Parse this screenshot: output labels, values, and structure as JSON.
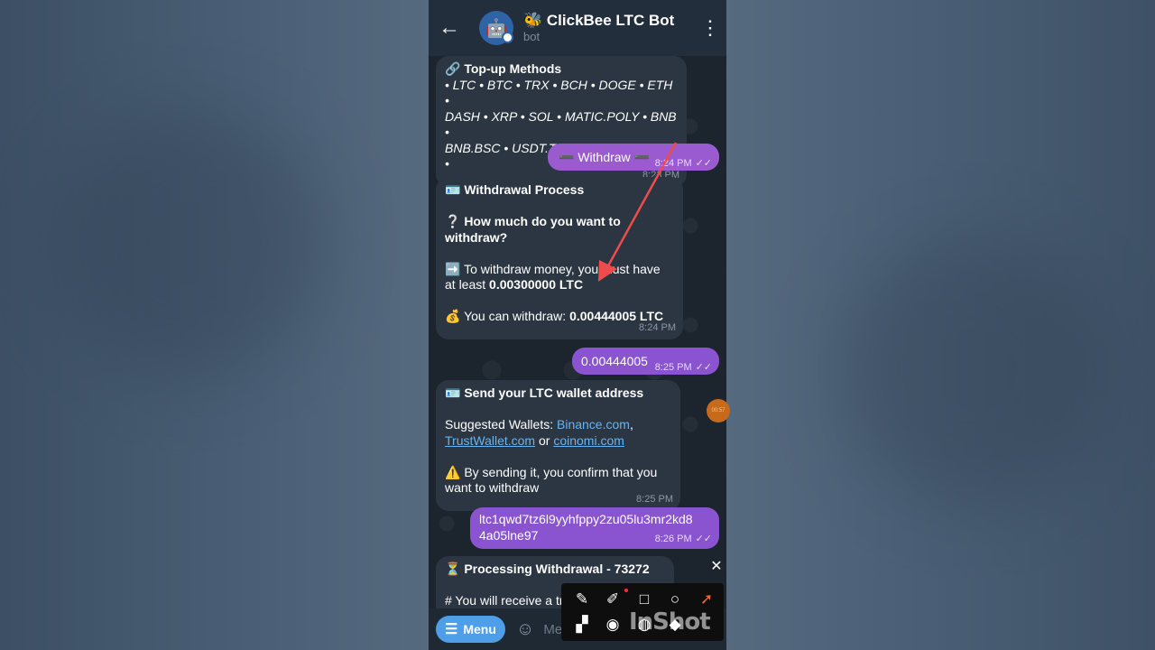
{
  "header": {
    "back_icon": "arrow-left-icon",
    "avatar_icon": "bee-robot-icon",
    "title": "🐝 ClickBee LTC Bot",
    "subtitle": "bot",
    "menu_icon": "more-vert-icon"
  },
  "messages": {
    "m1": {
      "heading": "Top-up Methods",
      "heading_icon": "link-icon",
      "line1": "• LTC • BTC • TRX • BCH • DOGE • ETH •",
      "line2": "DASH • XRP • SOL • MATIC.POLY • BNB •",
      "line3": "BNB.BSC • USDT.TRC20 • USDT.BEP20 •",
      "time": "8:23 PM"
    },
    "m2": {
      "text": "➖ Withdraw ➖",
      "time": "8:24 PM"
    },
    "m3": {
      "heading": "🪪 Withdrawal Process",
      "q1": "❔ How much do you want to",
      "q2": "withdraw?",
      "info1": "➡️ To withdraw money, you must have",
      "info2_prefix": "at least ",
      "info2_value": "0.00300000 LTC",
      "can_prefix": "💰 You can withdraw: ",
      "can_value": "0.00444005 LTC",
      "time": "8:24 PM"
    },
    "m4": {
      "text": "0.00444005",
      "time": "8:25 PM"
    },
    "m5": {
      "heading": "🪪 Send your LTC wallet address",
      "suggested_prefix": "Suggested Wallets: ",
      "link1": "Binance.com",
      "comma": ",",
      "link2": "TrustWallet.com",
      "or": " or ",
      "link3": "coinomi.com",
      "warn1": "⚠️ By sending it, you confirm that you",
      "warn2": "want to withdraw",
      "time": "8:25 PM"
    },
    "m6": {
      "line1": "ltc1qwd7tz6l9yyhfppy2zu05lu3mr2kd8",
      "line2": "4a05lne97",
      "time": "8:26 PM"
    },
    "m7": {
      "heading": "⏳ Processing Withdrawal - 73272",
      "line": "# You will receive a transaction"
    }
  },
  "bottom": {
    "menu_label": "Menu",
    "menu_icon": "hamburger-icon",
    "emoji_icon": "smiley-icon",
    "input_placeholder": "Me"
  },
  "overlay": {
    "close_icon": "close-icon",
    "tools": [
      "pen-icon",
      "marker-icon",
      "square-icon",
      "circle-icon",
      "arrow-icon",
      "mosaic-icon",
      "camera-icon",
      "color-wheel-icon",
      "eraser-icon"
    ],
    "watermark": "InShot",
    "arrow_color": "#ef4b4b",
    "coin_text": "00:57"
  }
}
